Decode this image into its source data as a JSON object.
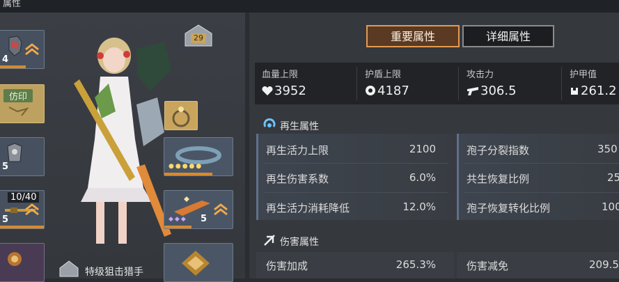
{
  "topbar": {
    "title": "属性",
    "center": "",
    "right": ""
  },
  "left": {
    "house_level": "29",
    "left_slots": [
      {
        "level": "4"
      },
      {
        "tag": "仿印"
      },
      {
        "level": "5"
      },
      {
        "count": "10/40",
        "level": "5"
      },
      {
        "level": ""
      }
    ],
    "right_slots": [
      {
        "level": ""
      },
      {
        "level": "5"
      },
      {
        "level": ""
      }
    ],
    "class_name": "特级狙击猎手"
  },
  "tabs": [
    {
      "label": "重要属性",
      "active": true
    },
    {
      "label": "详细属性",
      "active": false
    }
  ],
  "top_stats": [
    {
      "label": "血量上限",
      "icon": "heart-icon",
      "value": "3952"
    },
    {
      "label": "护盾上限",
      "icon": "shield-icon",
      "value": "4187"
    },
    {
      "label": "攻击力",
      "icon": "gun-icon",
      "value": "306.5"
    },
    {
      "label": "护甲值",
      "icon": "armor-icon",
      "value": "261.2"
    }
  ],
  "regen": {
    "title": "再生属性",
    "left_rows": [
      {
        "label": "再生活力上限",
        "value": "2100"
      },
      {
        "label": "再生伤害系数",
        "value": "6.0%"
      },
      {
        "label": "再生活力消耗降低",
        "value": "12.0%"
      }
    ],
    "right_rows": [
      {
        "label": "孢子分裂指数",
        "value": "350"
      },
      {
        "label": "共生恢复比例",
        "value": "25"
      },
      {
        "label": "孢子恢复转化比例",
        "value": "100"
      }
    ]
  },
  "damage": {
    "title": "伤害属性",
    "left_rows": [
      {
        "label": "伤害加成",
        "value": "265.3%"
      }
    ],
    "right_rows": [
      {
        "label": "伤害减免",
        "value": "209.5"
      }
    ]
  },
  "colors": {
    "accent": "#e59a52",
    "panel": "#35383d",
    "statbar": "#212327"
  }
}
